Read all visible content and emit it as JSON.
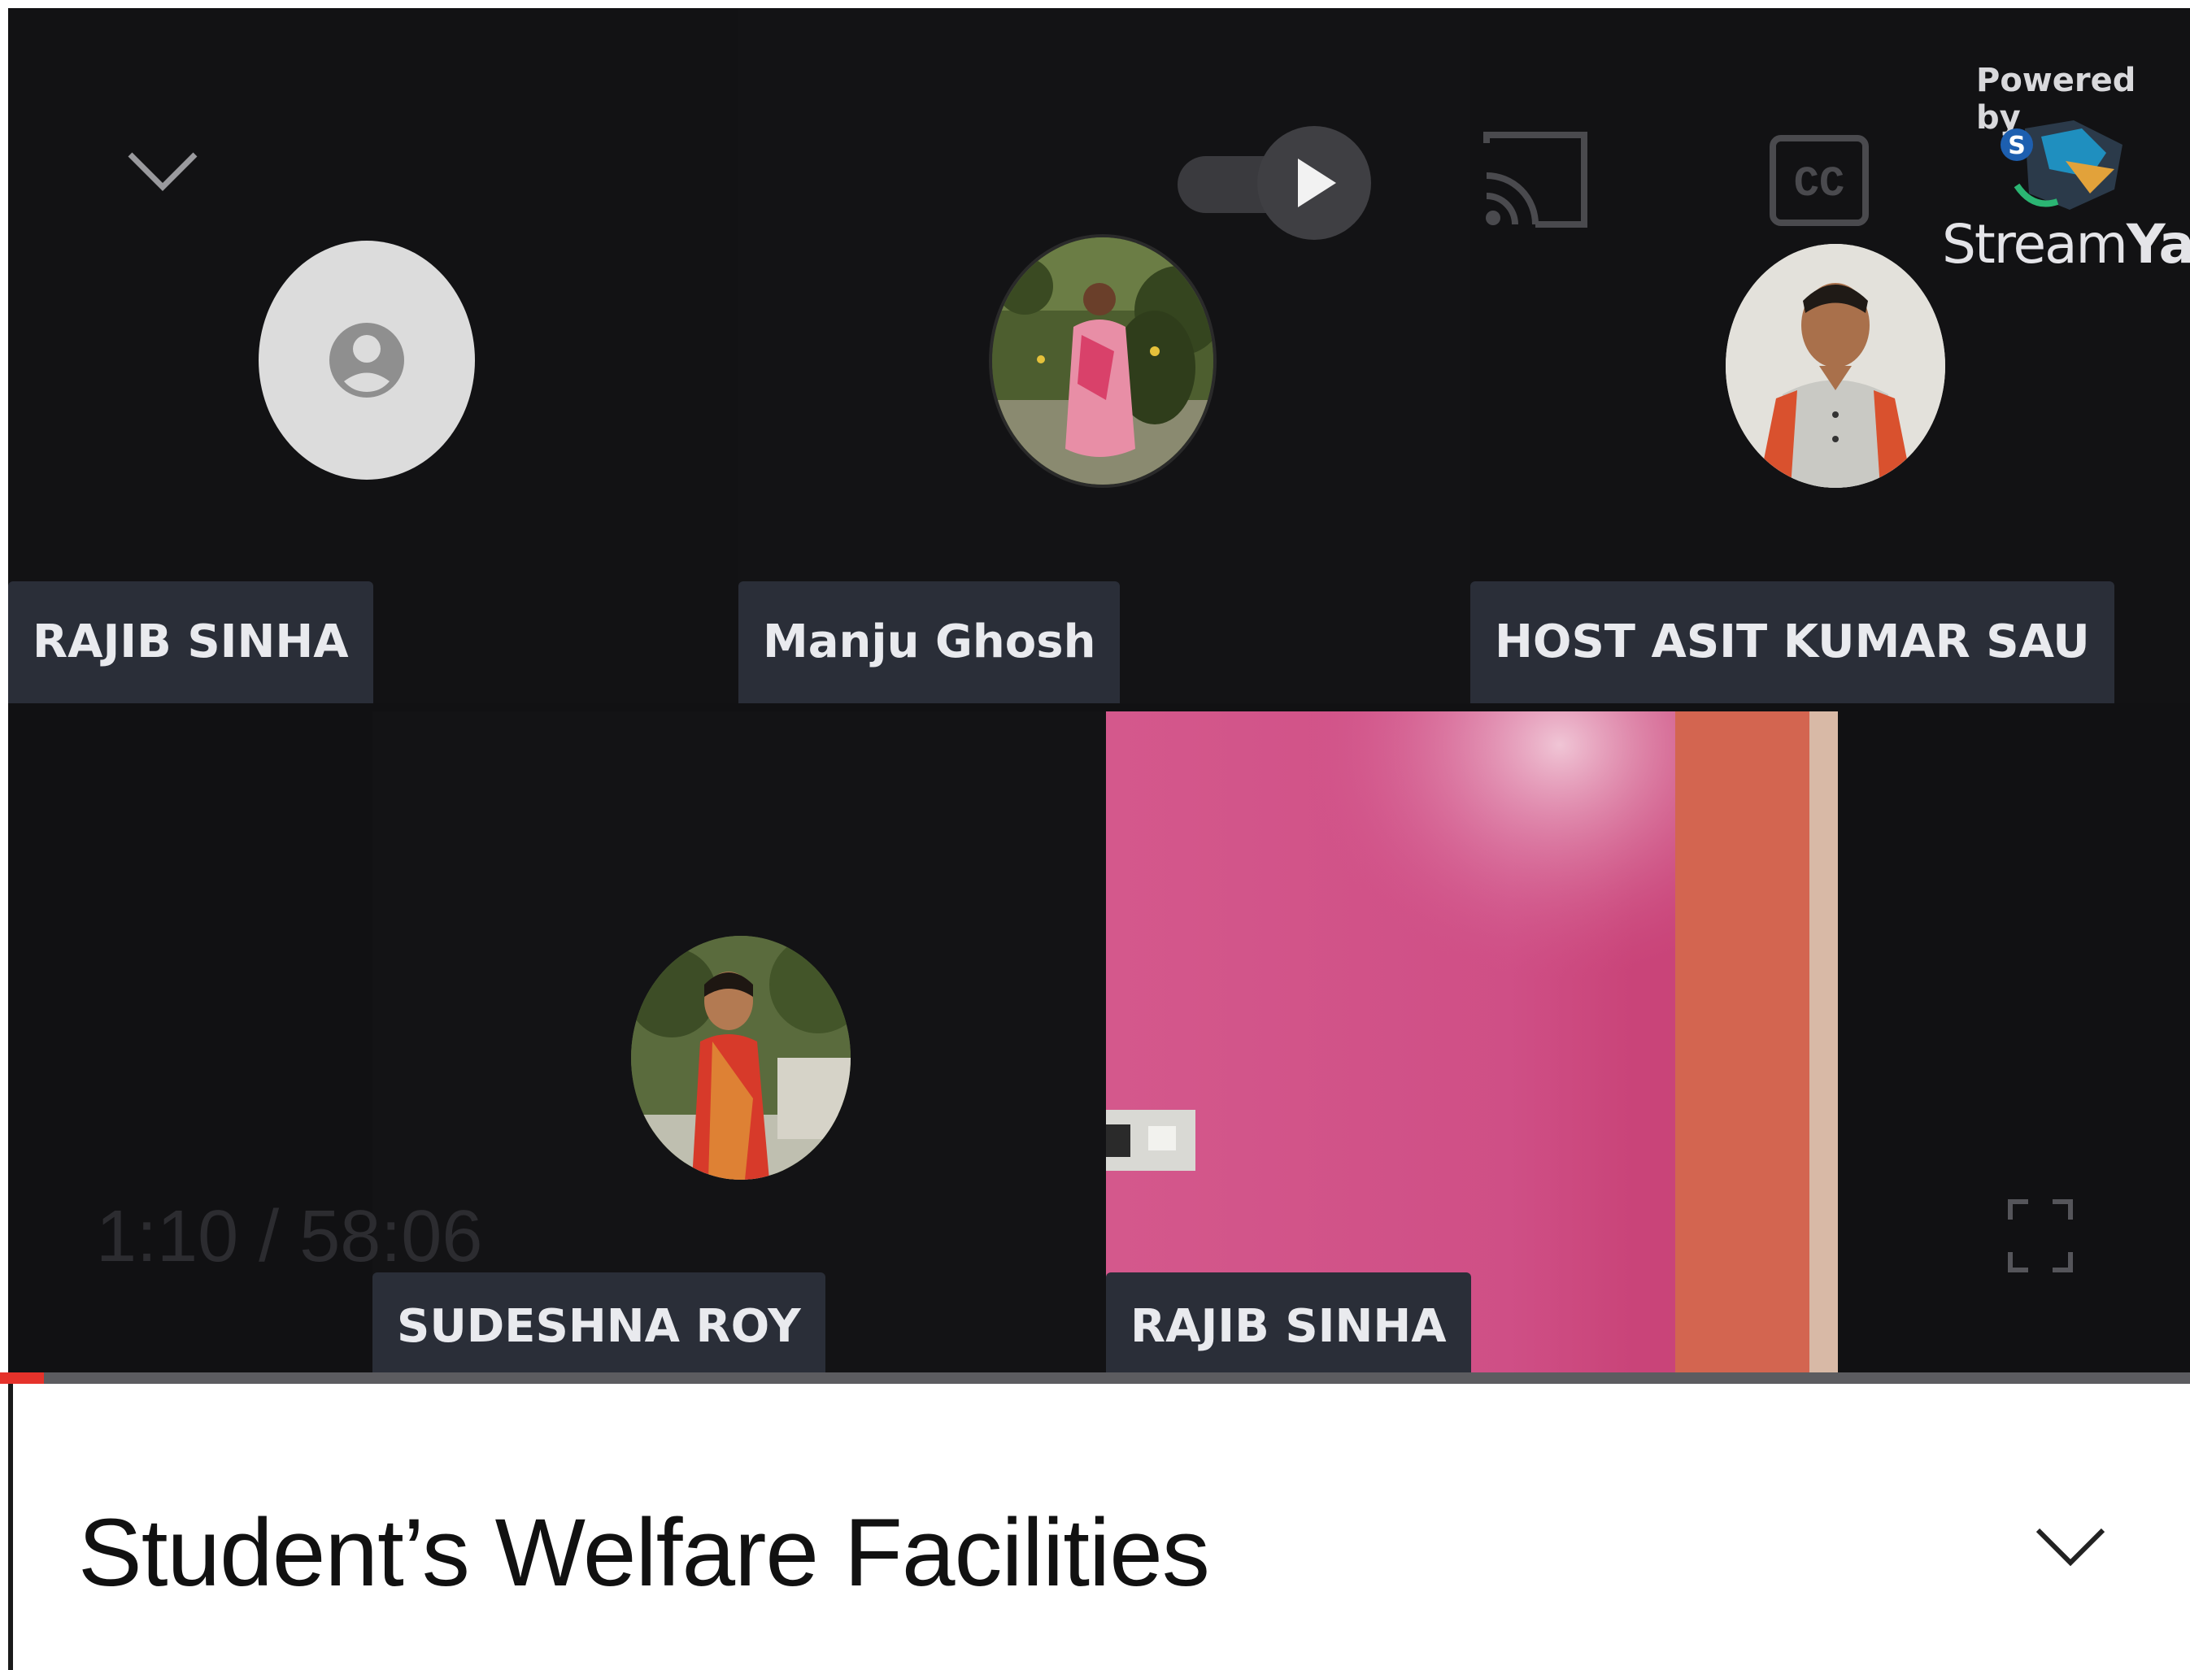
{
  "video": {
    "time_current": "1:10",
    "time_separator": " / ",
    "time_total": "58:06",
    "progress_fraction": 0.02
  },
  "branding": {
    "powered_by": "Powered by",
    "logo_prefix": "Stream",
    "logo_suffix": "Yard"
  },
  "participants": [
    {
      "name": "RAJIB SINHA",
      "avatar": "placeholder-person-icon"
    },
    {
      "name": "Manju Ghosh",
      "avatar": "photo"
    },
    {
      "name": "HOST ASIT KUMAR SAU",
      "avatar": "photo"
    },
    {
      "name": "SUDESHNA ROY",
      "avatar": "photo"
    },
    {
      "name": "RAJIB SINHA",
      "avatar": "camera-feed"
    }
  ],
  "title": {
    "text": "Student’s Welfare Facilities"
  },
  "colors": {
    "video_bg": "#111113",
    "nametag_bg": "#2a2e38",
    "progress": "#e5322b",
    "camera_wall": "#c9457a"
  },
  "icons": [
    "chevron-down-icon",
    "play-icon",
    "cast-icon",
    "captions-icon",
    "fullscreen-icon",
    "streamyard-logo-icon",
    "placeholder-person-icon"
  ]
}
